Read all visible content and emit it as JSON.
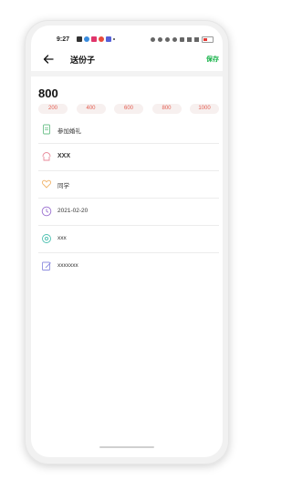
{
  "status_bar": {
    "time": "9:27"
  },
  "nav": {
    "title": "送份子",
    "save_label": "保存"
  },
  "gift": {
    "amount": "800",
    "preset_amounts": [
      "200",
      "400",
      "600",
      "800",
      "1000"
    ]
  },
  "rows": [
    {
      "icon": "document-icon",
      "label": "参加婚礼"
    },
    {
      "icon": "gift-tag-icon",
      "label": "XXX"
    },
    {
      "icon": "heart-icon",
      "label": "同学"
    },
    {
      "icon": "clock-icon",
      "label": "2021-02-20"
    },
    {
      "icon": "location-pin-icon",
      "label": "xxx"
    },
    {
      "icon": "edit-note-icon",
      "label": "xxxxxxx"
    }
  ],
  "colors": {
    "accent_green": "#18b34a",
    "chip_text": "#e35b4f",
    "chip_bg": "#f7f0ef"
  }
}
